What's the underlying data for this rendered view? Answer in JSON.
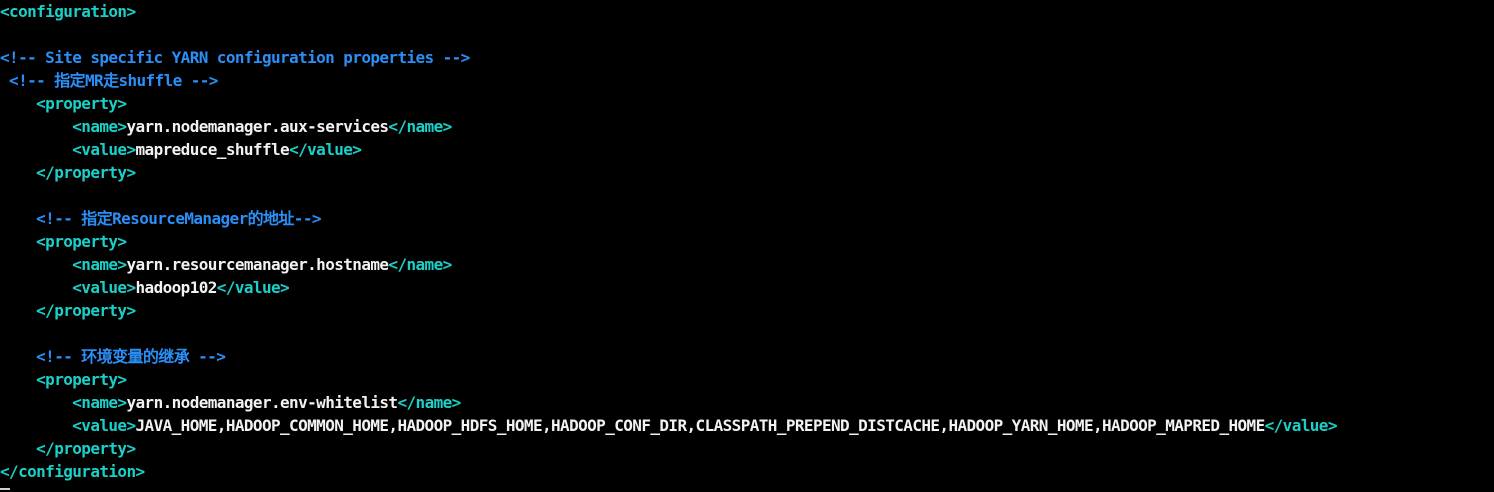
{
  "colors": {
    "background": "#000000",
    "tag": "#1ad0c8",
    "comment": "#2a8ff7",
    "text": "#f2f2f2"
  },
  "lines": [
    {
      "segments": [
        {
          "t": "tag",
          "v": "<configuration>"
        }
      ]
    },
    {
      "segments": []
    },
    {
      "segments": [
        {
          "t": "comment",
          "v": "<!-- Site specific YARN configuration properties -->"
        }
      ]
    },
    {
      "segments": [
        {
          "t": "comment",
          "v": " <!-- 指定MR走shuffle -->"
        }
      ]
    },
    {
      "segments": [
        {
          "t": "text",
          "v": "    "
        },
        {
          "t": "tag",
          "v": "<property>"
        }
      ]
    },
    {
      "segments": [
        {
          "t": "text",
          "v": "        "
        },
        {
          "t": "tag",
          "v": "<name>"
        },
        {
          "t": "text",
          "v": "yarn.nodemanager.aux-services"
        },
        {
          "t": "tag",
          "v": "</name>"
        }
      ]
    },
    {
      "segments": [
        {
          "t": "text",
          "v": "        "
        },
        {
          "t": "tag",
          "v": "<value>"
        },
        {
          "t": "text",
          "v": "mapreduce_shuffle"
        },
        {
          "t": "tag",
          "v": "</value>"
        }
      ]
    },
    {
      "segments": [
        {
          "t": "text",
          "v": "    "
        },
        {
          "t": "tag",
          "v": "</property>"
        }
      ]
    },
    {
      "segments": []
    },
    {
      "segments": [
        {
          "t": "text",
          "v": "    "
        },
        {
          "t": "comment",
          "v": "<!-- 指定ResourceManager的地址-->"
        }
      ]
    },
    {
      "segments": [
        {
          "t": "text",
          "v": "    "
        },
        {
          "t": "tag",
          "v": "<property>"
        }
      ]
    },
    {
      "segments": [
        {
          "t": "text",
          "v": "        "
        },
        {
          "t": "tag",
          "v": "<name>"
        },
        {
          "t": "text",
          "v": "yarn.resourcemanager.hostname"
        },
        {
          "t": "tag",
          "v": "</name>"
        }
      ]
    },
    {
      "segments": [
        {
          "t": "text",
          "v": "        "
        },
        {
          "t": "tag",
          "v": "<value>"
        },
        {
          "t": "text",
          "v": "hadoop102"
        },
        {
          "t": "tag",
          "v": "</value>"
        }
      ]
    },
    {
      "segments": [
        {
          "t": "text",
          "v": "    "
        },
        {
          "t": "tag",
          "v": "</property>"
        }
      ]
    },
    {
      "segments": []
    },
    {
      "segments": [
        {
          "t": "text",
          "v": "    "
        },
        {
          "t": "comment",
          "v": "<!-- 环境变量的继承 -->"
        }
      ]
    },
    {
      "segments": [
        {
          "t": "text",
          "v": "    "
        },
        {
          "t": "tag",
          "v": "<property>"
        }
      ]
    },
    {
      "segments": [
        {
          "t": "text",
          "v": "        "
        },
        {
          "t": "tag",
          "v": "<name>"
        },
        {
          "t": "text",
          "v": "yarn.nodemanager.env-whitelist"
        },
        {
          "t": "tag",
          "v": "</name>"
        }
      ]
    },
    {
      "segments": [
        {
          "t": "text",
          "v": "        "
        },
        {
          "t": "tag",
          "v": "<value>"
        },
        {
          "t": "text",
          "v": "JAVA_HOME,HADOOP_COMMON_HOME,HADOOP_HDFS_HOME,HADOOP_CONF_DIR,CLASSPATH_PREPEND_DISTCACHE,HADOOP_YARN_HOME,HADOOP_MAPRED_HOME"
        },
        {
          "t": "tag",
          "v": "</value>"
        }
      ]
    },
    {
      "segments": [
        {
          "t": "text",
          "v": "    "
        },
        {
          "t": "tag",
          "v": "</property>"
        }
      ]
    },
    {
      "segments": [
        {
          "t": "tag",
          "v": "</configuration>"
        }
      ]
    }
  ]
}
